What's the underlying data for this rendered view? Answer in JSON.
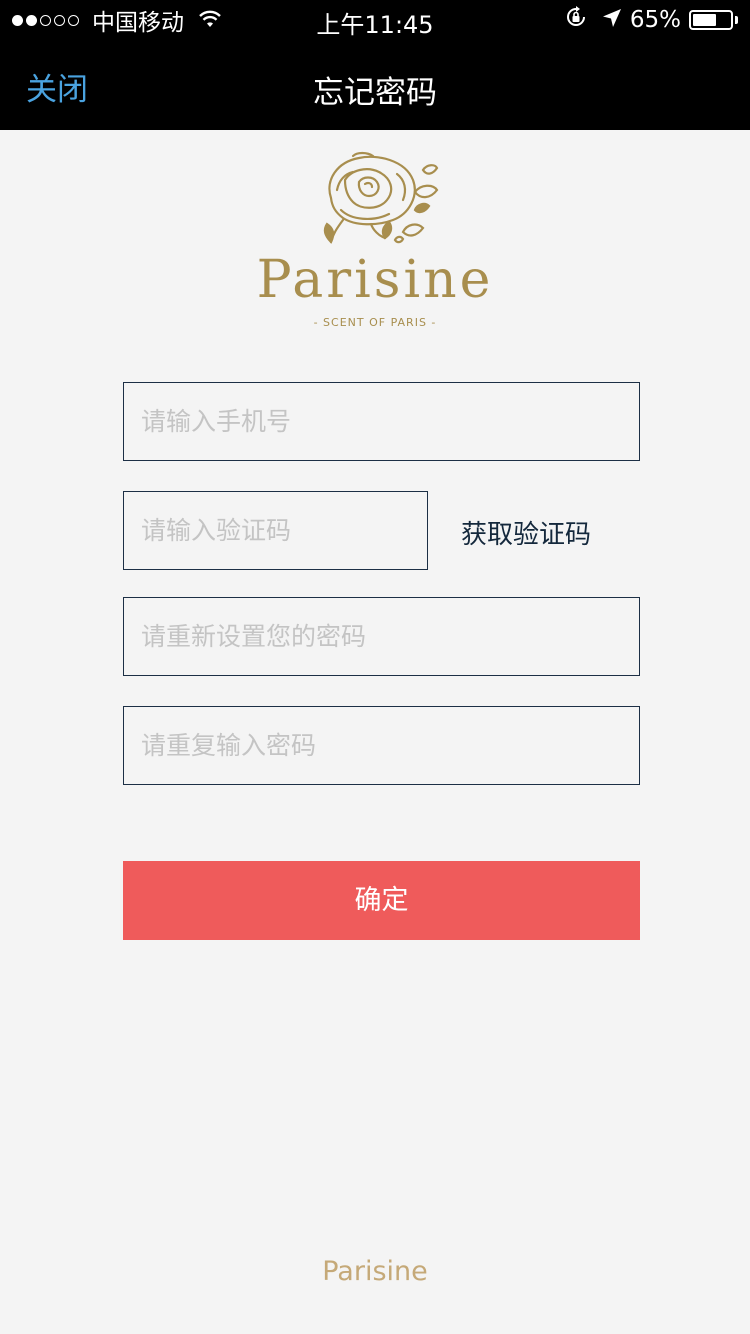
{
  "status_bar": {
    "carrier": "中国移动",
    "time": "上午11:45",
    "battery_percent": "65%",
    "battery_level": 0.65,
    "signal_strength": 2,
    "signal_max": 5
  },
  "nav": {
    "close_label": "关闭",
    "title": "忘记密码"
  },
  "logo": {
    "wordmark": "Parisine",
    "tagline": "- SCENT OF PARIS -"
  },
  "form": {
    "phone_placeholder": "请输入手机号",
    "code_placeholder": "请输入验证码",
    "get_code_label": "获取验证码",
    "new_password_placeholder": "请重新设置您的密码",
    "repeat_password_placeholder": "请重复输入密码",
    "confirm_label": "确定"
  },
  "footer": {
    "brand": "Parisine"
  },
  "colors": {
    "link_blue": "#4aa3e0",
    "gold": "#a88e4e",
    "confirm_red": "#ef5b5b",
    "field_border": "#1c2f45"
  }
}
